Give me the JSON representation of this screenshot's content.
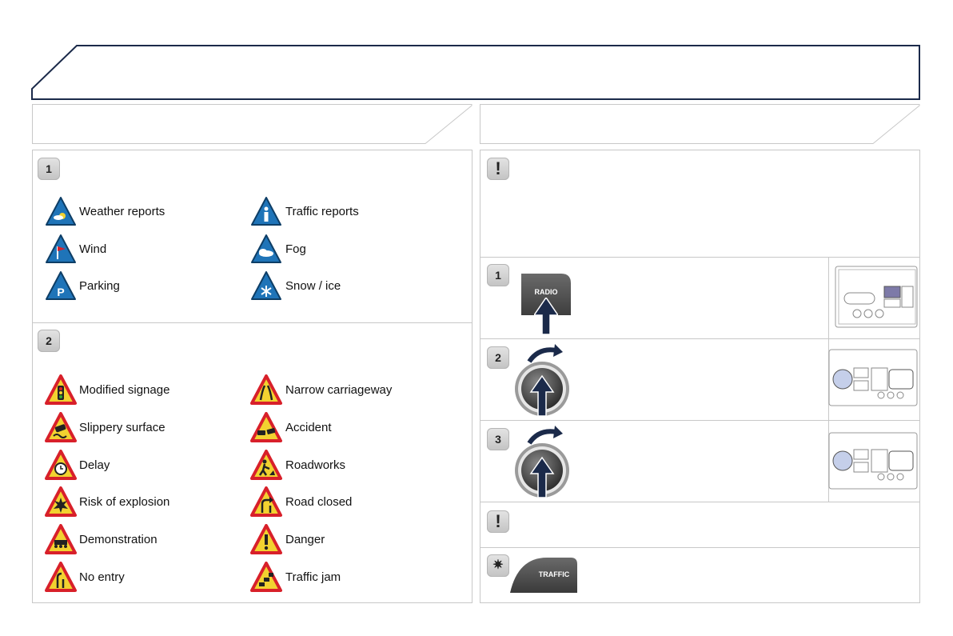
{
  "section1": {
    "badge": "1",
    "items": [
      {
        "label": "Weather reports",
        "icon": "weather-icon"
      },
      {
        "label": "Traffic reports",
        "icon": "info-icon"
      },
      {
        "label": "Wind",
        "icon": "wind-icon"
      },
      {
        "label": "Fog",
        "icon": "fog-icon"
      },
      {
        "label": "Parking",
        "icon": "parking-icon"
      },
      {
        "label": "Snow / ice",
        "icon": "snowflake-icon"
      }
    ]
  },
  "section2": {
    "badge": "2",
    "items": [
      {
        "label": "Modified signage",
        "icon": "traffic-light-icon"
      },
      {
        "label": "Narrow carriageway",
        "icon": "narrow-road-icon"
      },
      {
        "label": "Slippery surface",
        "icon": "slippery-icon"
      },
      {
        "label": "Accident",
        "icon": "accident-icon"
      },
      {
        "label": "Delay",
        "icon": "clock-icon"
      },
      {
        "label": "Roadworks",
        "icon": "roadworks-icon"
      },
      {
        "label": "Risk of explosion",
        "icon": "explosion-icon"
      },
      {
        "label": "Road closed",
        "icon": "road-closed-icon"
      },
      {
        "label": "Demonstration",
        "icon": "demonstration-icon"
      },
      {
        "label": "Danger",
        "icon": "danger-icon"
      },
      {
        "label": "No entry",
        "icon": "no-entry-icon"
      },
      {
        "label": "Traffic jam",
        "icon": "traffic-jam-icon"
      }
    ]
  },
  "right": {
    "warning_badge": "!",
    "steps": [
      {
        "badge": "1",
        "button_label": "RADIO"
      },
      {
        "badge": "2"
      },
      {
        "badge": "3"
      }
    ],
    "warning2_badge": "!",
    "traffic_button_label": "TRAFFIC",
    "colors": {
      "navy": "#1b2a4a",
      "sign_blue": "#1f74b8",
      "sign_red": "#d8202a",
      "sign_yellow": "#f2d230"
    }
  }
}
